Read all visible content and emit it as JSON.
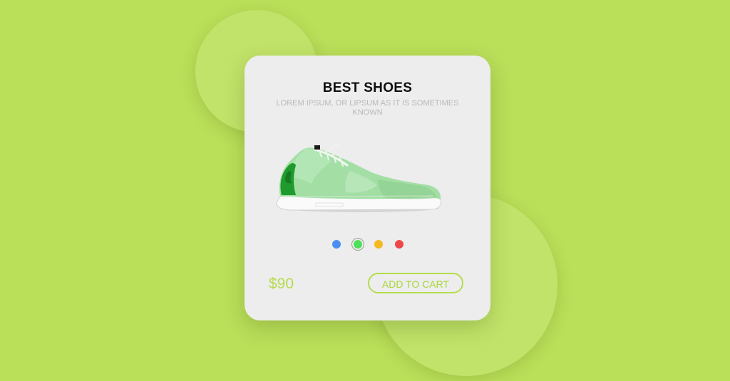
{
  "product": {
    "title": "BEST SHOES",
    "subtitle": "LOREM IPSUM, OR LIPSUM AS IT IS SOMETIMES KNOWN",
    "image_label": "green sneaker",
    "price": "$90",
    "add_to_cart_label": "ADD TO CART"
  },
  "color_options": [
    {
      "name": "blue",
      "color": "#4a8ff0",
      "selected": false
    },
    {
      "name": "green",
      "color": "#4ee05a",
      "selected": true
    },
    {
      "name": "yellow",
      "color": "#f4b821",
      "selected": false
    },
    {
      "name": "red",
      "color": "#ef4748",
      "selected": false
    }
  ],
  "theme": {
    "background": "#badf59",
    "accent": "#b5dc4e",
    "card": "#ededed"
  }
}
